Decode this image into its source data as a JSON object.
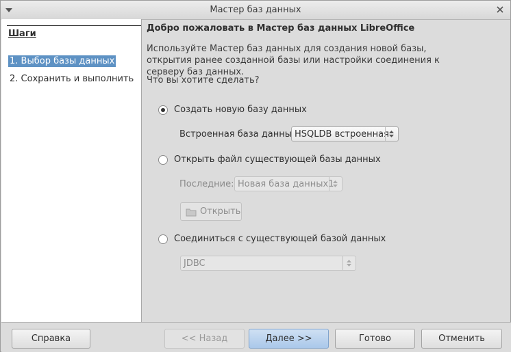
{
  "window": {
    "title": "Мастер баз данных"
  },
  "sidebar": {
    "title": "Шаги",
    "steps": [
      {
        "label": "1. Выбор базы данных",
        "active": true
      },
      {
        "label": "2. Сохранить и выполнить",
        "active": false
      }
    ]
  },
  "main": {
    "heading": "Добро пожаловать в Мастер баз данных LibreOffice",
    "intro": "Используйте Мастер баз данных для создания новой базы, открытия ранее созданной базы или настройки соединения к серверу баз данных.",
    "question": "Что вы хотите сделать?",
    "options": {
      "create_label": "Создать новую базу данных",
      "create_checked": true,
      "embedded_label": "Встроенная база данных",
      "embedded_value": "HSQLDB встроенная",
      "open_label": "Открыть файл существующей базы данных",
      "recent_label": "Последние:",
      "recent_value": "Новая база данных1",
      "open_button": "Открыть",
      "connect_label": "Соединиться с существующей базой данных",
      "connect_value": "JDBC"
    }
  },
  "footer": {
    "help": "Справка",
    "back": "<< Назад",
    "next": "Далее >>",
    "finish": "Готово",
    "cancel": "Отменить"
  },
  "colors": {
    "selection": "#5e92c4",
    "primary_button": "#aac8ea"
  },
  "icons": [
    "window-menu-icon",
    "close-icon",
    "folder-open-icon",
    "spin-arrows-icon"
  ]
}
